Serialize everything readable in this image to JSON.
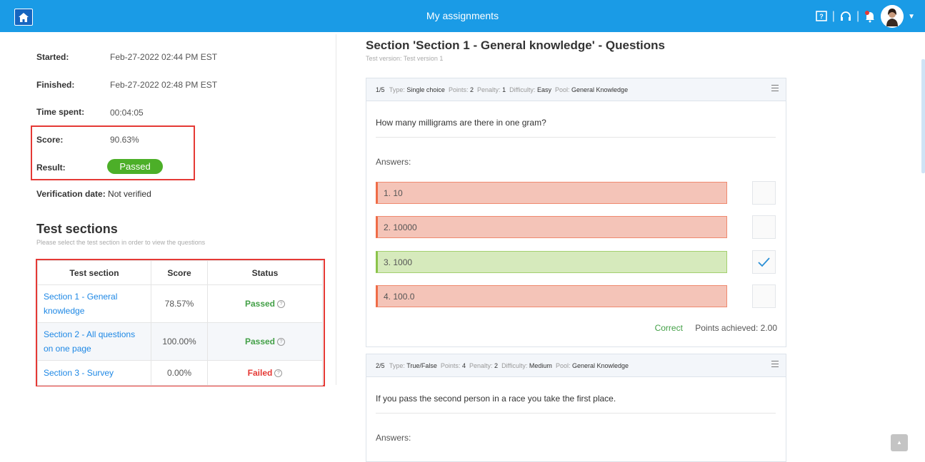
{
  "header": {
    "title": "My assignments"
  },
  "info": {
    "started_label": "Started:",
    "started_value": "Feb-27-2022 02:44 PM EST",
    "finished_label": "Finished:",
    "finished_value": "Feb-27-2022 02:48 PM EST",
    "time_label": "Time spent:",
    "time_value": "00:04:05",
    "score_label": "Score:",
    "score_value": "90.63%",
    "result_label": "Result:",
    "result_value": "Passed",
    "verif_label": "Verification date:",
    "verif_value": "Not verified"
  },
  "test_sections": {
    "title": "Test sections",
    "subtitle": "Please select the test section in order to view the questions",
    "columns": [
      "Test section",
      "Score",
      "Status"
    ],
    "rows": [
      {
        "name_line1": "Section 1 - General",
        "name_line2": "knowledge",
        "score": "78.57%",
        "status": "Passed"
      },
      {
        "name_line1": "Section 2 - All questions",
        "name_line2": "on one page",
        "score": "100.00%",
        "status": "Passed"
      },
      {
        "name_line1": "Section 3 - Survey",
        "name_line2": "",
        "score": "0.00%",
        "status": "Failed"
      }
    ]
  },
  "questions_section": {
    "heading": "Section 'Section 1 - General knowledge' - Questions",
    "version": "Test version: Test version 1"
  },
  "questions": [
    {
      "number": "1/5",
      "type_label": "Type:",
      "type": "Single choice",
      "points_label": "Points:",
      "points": "2",
      "penalty_label": "Penalty:",
      "penalty": "1",
      "difficulty_label": "Difficulty:",
      "difficulty": "Easy",
      "pool_label": "Pool:",
      "pool": "General Knowledge",
      "text": "How many milligrams are there in one gram?",
      "answers_label": "Answers:",
      "answers": [
        "1.  10",
        "2.  10000",
        "3.  1000",
        "4.  100.0"
      ],
      "result": "Correct",
      "points_achieved": "Points achieved: 2.00"
    },
    {
      "number": "2/5",
      "type_label": "Type:",
      "type": "True/False",
      "points_label": "Points:",
      "points": "4",
      "penalty_label": "Penalty:",
      "penalty": "2",
      "difficulty_label": "Difficulty:",
      "difficulty": "Medium",
      "pool_label": "Pool:",
      "pool": "General Knowledge",
      "text": "If you pass the second person in a race you take the first place.",
      "answers_label": "Answers:"
    }
  ],
  "icons": [
    "home-icon",
    "manual-icon",
    "headset-icon",
    "notification-bell-icon",
    "user-avatar",
    "menu-icon",
    "checkmark-icon",
    "help-circle-icon",
    "back-to-top-icon"
  ],
  "colors": {
    "topbar": "#1a9be6",
    "passed": "#4caf28",
    "wrong_answer": "#f4c4b8",
    "correct_answer": "#d6eabc",
    "highlight": "#e53935"
  }
}
